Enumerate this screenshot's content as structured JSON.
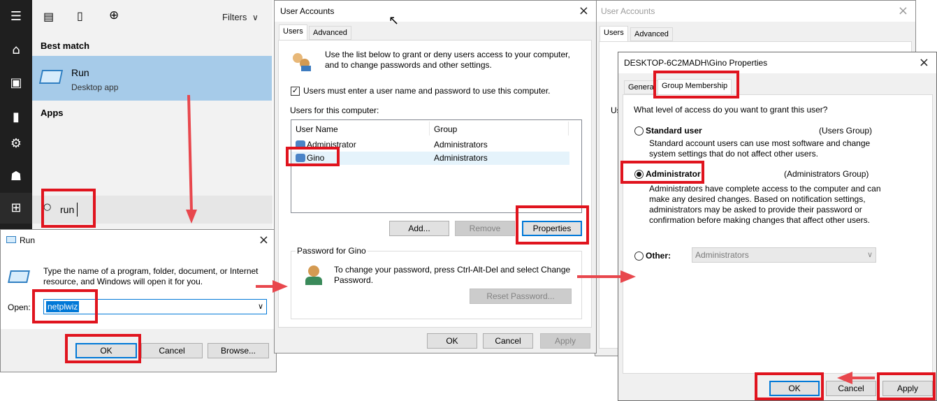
{
  "start": {
    "filters_label": "Filters",
    "best_match": "Best match",
    "result_title": "Run",
    "result_subtitle": "Desktop app",
    "apps_label": "Apps",
    "search_value": "run"
  },
  "run": {
    "title": "Run",
    "description": "Type the name of a program, folder, document, or Internet resource, and Windows will open it for you.",
    "open_label": "Open:",
    "open_value": "netplwiz",
    "ok": "OK",
    "cancel": "Cancel",
    "browse": "Browse..."
  },
  "ua1": {
    "title": "User Accounts",
    "tabs": [
      "Users",
      "Advanced"
    ],
    "intro": "Use the list below to grant or deny users access to your computer, and to change passwords and other settings.",
    "checkbox_label": "Users must enter a user name and password to use this computer.",
    "list_caption": "Users for this computer:",
    "columns": [
      "User Name",
      "Group"
    ],
    "rows": [
      {
        "name": "Administrator",
        "group": "Administrators"
      },
      {
        "name": "Gino",
        "group": "Administrators"
      }
    ],
    "add": "Add...",
    "remove": "Remove",
    "properties": "Properties",
    "password_group": "Password for Gino",
    "password_text": "To change your password, press Ctrl-Alt-Del and select Change Password.",
    "reset": "Reset Password...",
    "ok": "OK",
    "cancel": "Cancel",
    "apply": "Apply"
  },
  "ua2": {
    "title": "User Accounts",
    "tabs": [
      "Users",
      "Advanced"
    ],
    "peek_label": "Us"
  },
  "props": {
    "title": "DESKTOP-6C2MADH\\Gino Properties",
    "tabs": [
      "General",
      "Group Membership"
    ],
    "question": "What level of access do you want to grant this user?",
    "standard_label": "Standard user",
    "standard_group": "(Users Group)",
    "standard_desc": "Standard account users can use most software and change system settings that do not affect other users.",
    "admin_label": "Administrator",
    "admin_group": "(Administrators Group)",
    "admin_desc": "Administrators have complete access to the computer and can make any desired changes. Based on notification settings, administrators may be asked to provide their password or confirmation before making changes that affect other users.",
    "other_label": "Other:",
    "other_value": "Administrators",
    "ok": "OK",
    "cancel": "Cancel",
    "apply": "Apply"
  },
  "colors": {
    "accent": "#0078d7",
    "highlight": "#e0141e",
    "start_selected": "#a6cbe9",
    "taskbar": "#1f1f1f"
  }
}
